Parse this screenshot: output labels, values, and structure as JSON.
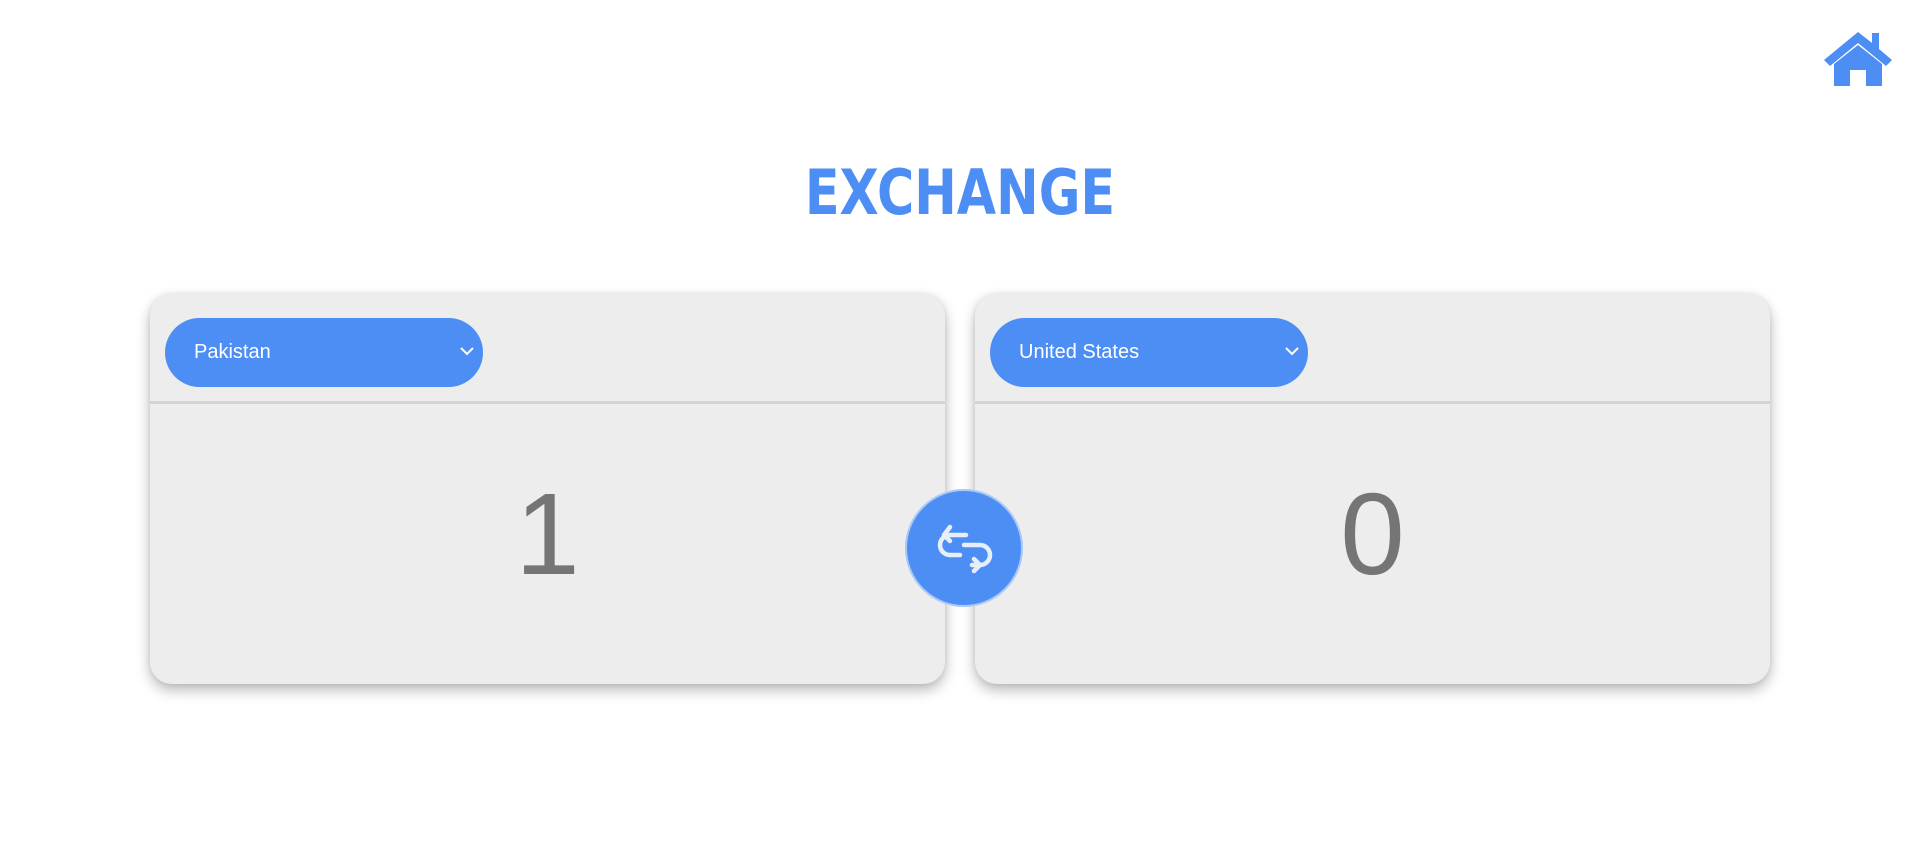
{
  "header": {
    "title": "EXCHANGE",
    "home_icon": "home-icon"
  },
  "colors": {
    "accent": "#4d8ef5",
    "card_bg": "#ededed",
    "amount_text": "#757575"
  },
  "from": {
    "country": "Pakistan",
    "amount": "1"
  },
  "to": {
    "country": "United States",
    "amount": "0"
  },
  "swap": {
    "icon": "swap-icon"
  }
}
